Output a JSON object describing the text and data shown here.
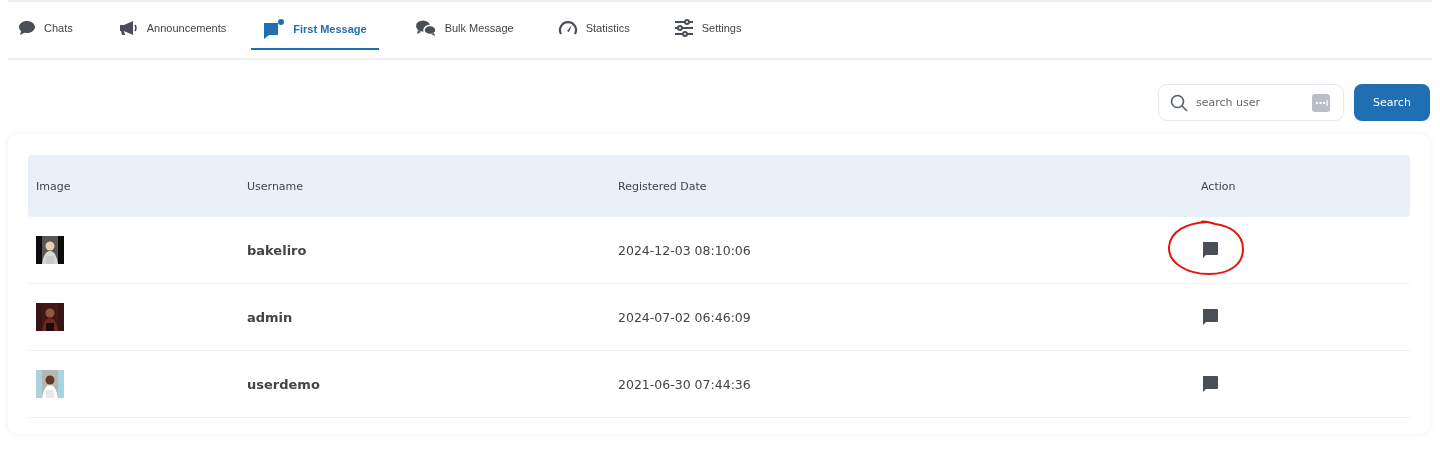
{
  "tabs": [
    {
      "label": "Chats",
      "selected": false
    },
    {
      "label": "Announcements",
      "selected": false
    },
    {
      "label": "First Message",
      "selected": true
    },
    {
      "label": "Bulk Message",
      "selected": false
    },
    {
      "label": "Statistics",
      "selected": false
    },
    {
      "label": "Settings",
      "selected": false
    }
  ],
  "search": {
    "placeholder": "search user",
    "button": "Search"
  },
  "table": {
    "columns": [
      "Image",
      "Username",
      "Registered Date",
      "Action"
    ],
    "rows": [
      {
        "username": "bakeliro",
        "registered": "2024-12-03 08:10:06",
        "circled": true
      },
      {
        "username": "admin",
        "registered": "2024-07-02 06:46:09",
        "circled": false
      },
      {
        "username": "userdemo",
        "registered": "2021-06-30 07:44:36",
        "circled": false
      }
    ]
  }
}
